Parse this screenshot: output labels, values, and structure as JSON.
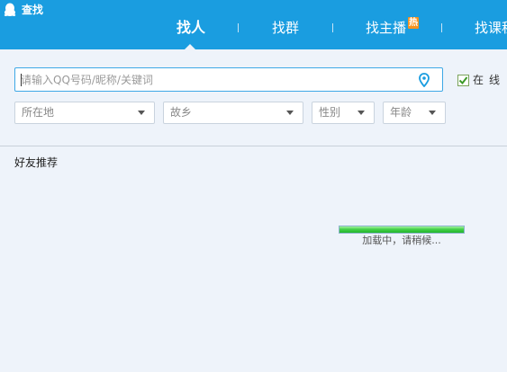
{
  "app": {
    "title": "查找"
  },
  "tabs": [
    {
      "label": "找人",
      "active": true
    },
    {
      "label": "找群"
    },
    {
      "label": "找主播",
      "badge": "热"
    },
    {
      "label": "找课程"
    }
  ],
  "search": {
    "placeholder": "请输入QQ号码/昵称/关键词",
    "value": "",
    "location_icon": "location-pin-icon",
    "online_only": {
      "label": "在线",
      "checked": true
    }
  },
  "filters": [
    {
      "label": "所在地"
    },
    {
      "label": "故乡"
    },
    {
      "label": "性别"
    },
    {
      "label": "年龄"
    }
  ],
  "section": {
    "title": "好友推荐"
  },
  "loading": {
    "text": "加载中，请稍候...",
    "progress": 1.0
  },
  "colors": {
    "titlebar": "#1a9de0",
    "background": "#eef3fa",
    "input_border": "#3ea8e6",
    "hot_badge": "#f7931e",
    "checkbox": "#3c9a28",
    "progress": "#2fc236"
  }
}
